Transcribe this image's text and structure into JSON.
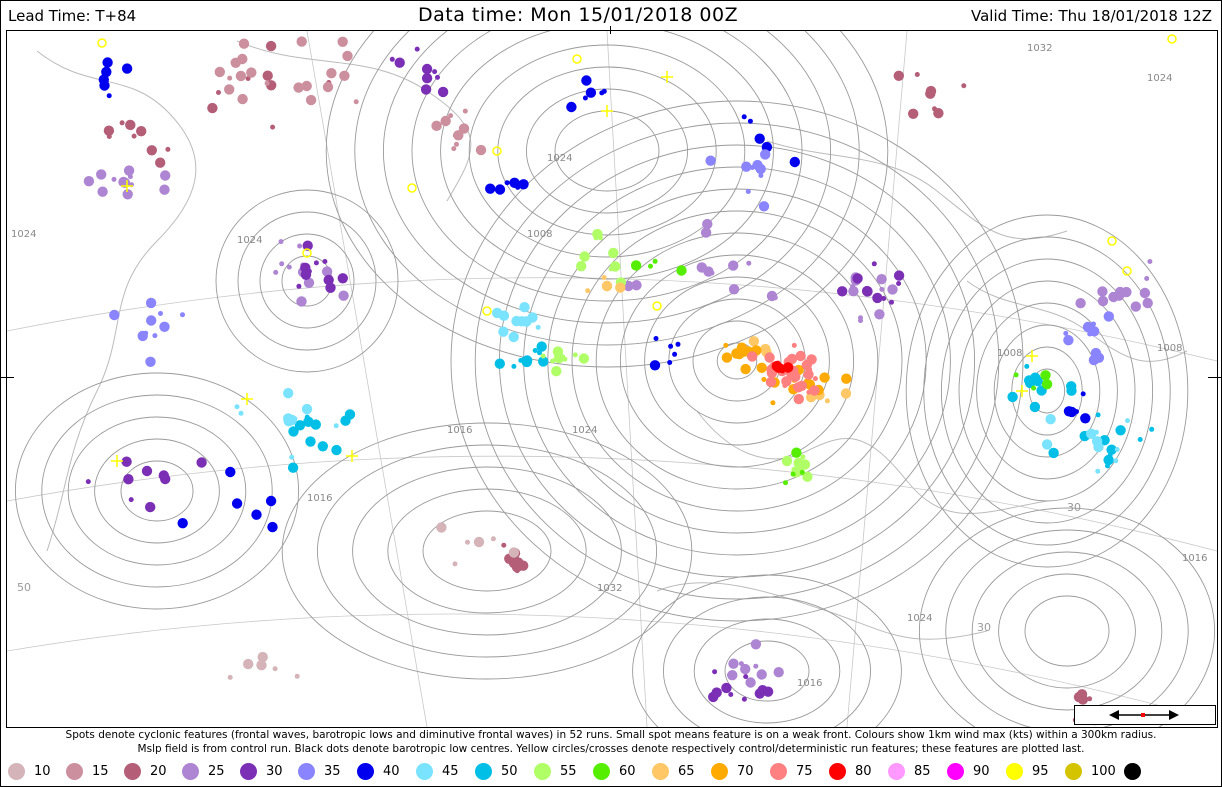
{
  "header": {
    "lead_time": "Lead Time: T+84",
    "data_time": "Data time:  Mon 15/01/2018 00Z",
    "valid_time": "Valid Time: Thu 18/01/2018 12Z"
  },
  "caption": {
    "line1": "Spots denote cyclonic features (frontal waves, barotropic lows and diminutive frontal waves) in 52 runs. Small spot means feature is on a weak front. Colours show 1km wind max (kts) within a 300km radius.",
    "line2": "Mslp field is from control run. Black dots denote barotropic low centres. Yellow circles/crosses denote respectively control/deterministic run features; these features are plotted last."
  },
  "legend": [
    {
      "label": "10",
      "color": "#d4b4b8"
    },
    {
      "label": "15",
      "color": "#cc8f9e"
    },
    {
      "label": "20",
      "color": "#b45e78"
    },
    {
      "label": "25",
      "color": "#ad85d2"
    },
    {
      "label": "30",
      "color": "#7b2fb5"
    },
    {
      "label": "35",
      "color": "#8a84ff"
    },
    {
      "label": "40",
      "color": "#0000ee"
    },
    {
      "label": "45",
      "color": "#7ae3ff"
    },
    {
      "label": "50",
      "color": "#00bfe6"
    },
    {
      "label": "55",
      "color": "#b0ff66"
    },
    {
      "label": "60",
      "color": "#55ee00"
    },
    {
      "label": "65",
      "color": "#ffc766"
    },
    {
      "label": "70",
      "color": "#ffaa00"
    },
    {
      "label": "75",
      "color": "#ff8080"
    },
    {
      "label": "80",
      "color": "#ff0000"
    },
    {
      "label": "85",
      "color": "#ff99ff"
    },
    {
      "label": "90",
      "color": "#ff00ff"
    },
    {
      "label": "95",
      "color": "#ffff00"
    },
    {
      "label": "100",
      "color": "#d4c400"
    },
    {
      "label": "",
      "color": "#000000"
    }
  ],
  "isobar_labels": [
    "1024",
    "1024",
    "1008",
    "1024",
    "1016",
    "1024",
    "1016",
    "1032",
    "1024",
    "1016",
    "1016",
    "1008",
    "1008",
    "1024",
    "1032"
  ],
  "grid_labels": [
    "50",
    "30",
    "30"
  ],
  "clusters": [
    {
      "label": "25",
      "n": 70
    },
    {
      "label": "40",
      "n": 40
    },
    {
      "label": "30",
      "n": 50
    },
    {
      "label": "20",
      "n": 45
    },
    {
      "label": "15",
      "n": 30
    },
    {
      "label": "50",
      "n": 45
    },
    {
      "label": "45",
      "n": 30
    },
    {
      "label": "35",
      "n": 30
    },
    {
      "label": "55",
      "n": 30
    },
    {
      "label": "60",
      "n": 12
    },
    {
      "label": "65",
      "n": 15
    },
    {
      "label": "70",
      "n": 25
    },
    {
      "label": "75",
      "n": 30
    },
    {
      "label": "80",
      "n": 4
    },
    {
      "label": "10",
      "n": 12
    }
  ]
}
